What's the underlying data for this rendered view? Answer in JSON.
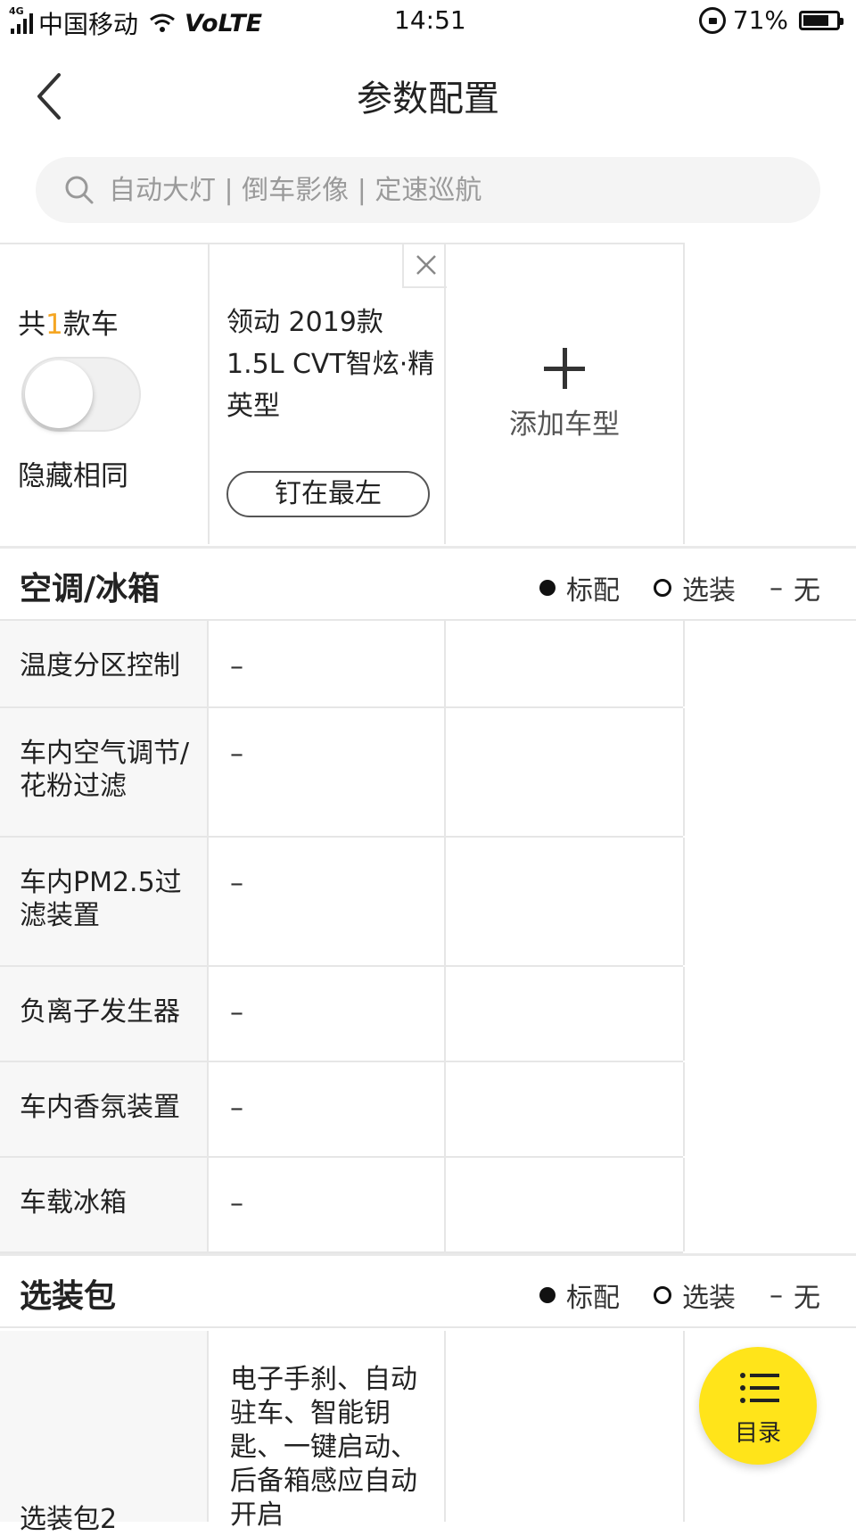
{
  "status_bar": {
    "network": "4G",
    "carrier": "中国移动",
    "volte": "VoLTE",
    "time": "14:51",
    "battery": "71%"
  },
  "nav": {
    "title": "参数配置"
  },
  "search": {
    "placeholder": "自动大灯 | 倒车影像 | 定速巡航"
  },
  "compare": {
    "count_prefix": "共",
    "count": "1",
    "count_suffix": "款车",
    "hide_same_label": "隐藏相同",
    "hide_same_on": false,
    "car_name": "领动 2019款 1.5L CVT智炫·精英型",
    "pin_label": "钉在最左",
    "add_car_label": "添加车型"
  },
  "legend": {
    "standard": "标配",
    "optional": "选装",
    "none_symbol": "–",
    "none": "无"
  },
  "sections": [
    {
      "title": "空调/冰箱",
      "rows": [
        {
          "label": "温度分区控制",
          "value": "–"
        },
        {
          "label": "车内空气调节/花粉过滤",
          "value": "–"
        },
        {
          "label": "车内PM2.5过滤装置",
          "value": "–"
        },
        {
          "label": "负离子发生器",
          "value": "–"
        },
        {
          "label": "车内香氛装置",
          "value": "–"
        },
        {
          "label": "车载冰箱",
          "value": "–"
        }
      ]
    },
    {
      "title": "选装包",
      "rows": [
        {
          "label": "选装包2",
          "value": "电子手刹、自动驻车、智能钥匙、一键启动、后备箱感应自动开启"
        }
      ]
    }
  ],
  "fab": {
    "label": "目录"
  }
}
